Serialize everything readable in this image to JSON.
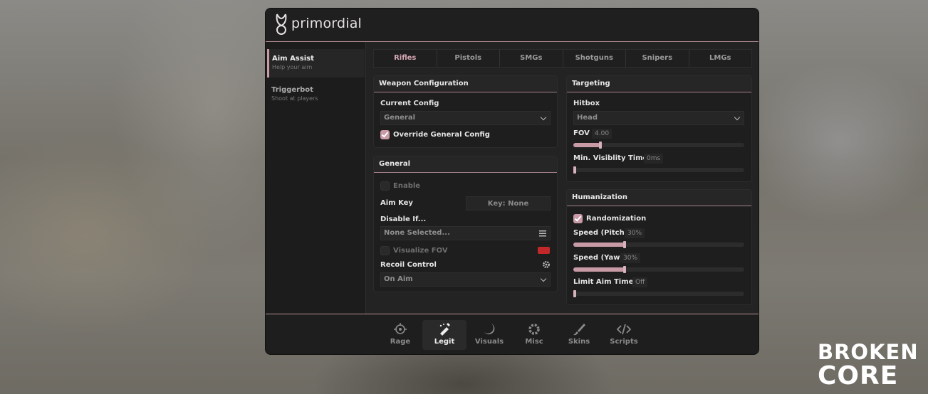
{
  "app": {
    "logo_text": "primordial"
  },
  "sidebar": {
    "items": [
      {
        "title": "Aim Assist",
        "subtitle": "Help your aim"
      },
      {
        "title": "Triggerbot",
        "subtitle": "Shoot at players"
      }
    ]
  },
  "tabs": [
    "Rifles",
    "Pistols",
    "SMGs",
    "Shotguns",
    "Snipers",
    "LMGs"
  ],
  "weapon_config": {
    "heading": "Weapon Configuration",
    "current_config_label": "Current Config",
    "current_config_value": "General",
    "override_label": "Override General Config",
    "override_checked": true
  },
  "general": {
    "heading": "General",
    "enable_label": "Enable",
    "enable_checked": false,
    "aim_key_label": "Aim Key",
    "aim_key_value": "Key: None",
    "disable_if_label": "Disable If...",
    "disable_if_value": "None Selected...",
    "visualize_fov_label": "Visualize FOV",
    "visualize_fov_checked": false,
    "visualize_fov_color": "#c0282a",
    "recoil_control_label": "Recoil Control",
    "recoil_control_value": "On Aim"
  },
  "targeting": {
    "heading": "Targeting",
    "hitbox_label": "Hitbox",
    "hitbox_value": "Head",
    "fov_label": "FOV",
    "fov_value": "4.00",
    "fov_fraction": 0.16,
    "min_vis_label": "Min. Visiblity Time",
    "min_vis_value": "0ms",
    "min_vis_fraction": 0.0
  },
  "humanization": {
    "heading": "Humanization",
    "randomization_label": "Randomization",
    "randomization_checked": true,
    "speed_pitch_label": "Speed (Pitch)",
    "speed_pitch_value": "30%",
    "speed_pitch_fraction": 0.3,
    "speed_yaw_label": "Speed (Yaw)",
    "speed_yaw_value": "30%",
    "speed_yaw_fraction": 0.3,
    "limit_aim_label": "Limit Aim Time",
    "limit_aim_value": "Off",
    "limit_aim_fraction": 0.0
  },
  "bottom_nav": [
    {
      "label": "Rage",
      "icon": "rage-icon"
    },
    {
      "label": "Legit",
      "icon": "legit-icon",
      "active": true
    },
    {
      "label": "Visuals",
      "icon": "visuals-icon"
    },
    {
      "label": "Misc",
      "icon": "gear-icon"
    },
    {
      "label": "Skins",
      "icon": "brush-icon"
    },
    {
      "label": "Scripts",
      "icon": "code-icon"
    }
  ],
  "watermark": {
    "line1": "BROKEN",
    "line2": "CORE"
  },
  "colors": {
    "accent": "#c89aa6",
    "window_bg": "#232323",
    "panel_bg": "#1e1e1e"
  }
}
